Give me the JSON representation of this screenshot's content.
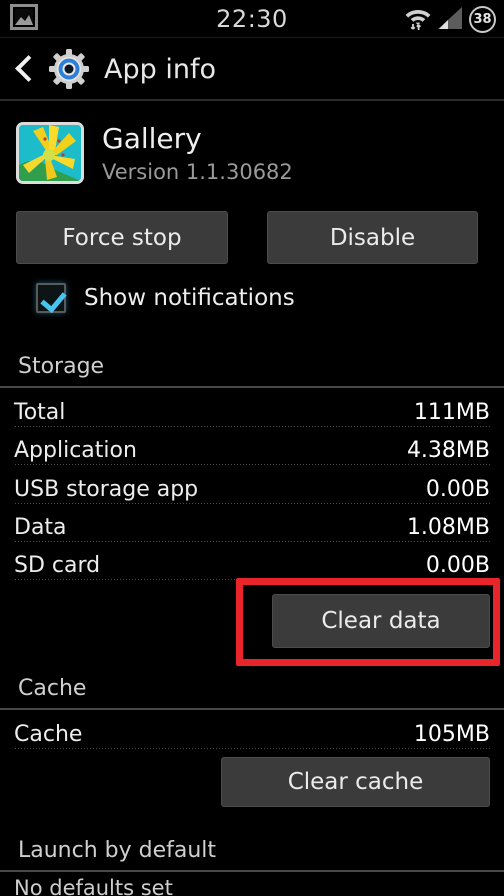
{
  "status_bar": {
    "notification_icon": "photo-icon",
    "clock": "22:30",
    "wifi_icon": "wifi-icon",
    "signal_icon": "cellular-signal-icon",
    "battery_level": "38"
  },
  "action_bar": {
    "back_icon": "back-chevron-icon",
    "app_icon": "settings-gear-icon",
    "title": "App info"
  },
  "app": {
    "icon": "gallery-app-icon",
    "name": "Gallery",
    "version": "Version 1.1.30682"
  },
  "actions": {
    "force_stop_label": "Force stop",
    "disable_label": "Disable"
  },
  "notifications": {
    "label": "Show notifications",
    "checked": true,
    "checkbox_icon": "checkbox-checked-icon"
  },
  "storage": {
    "header": "Storage",
    "rows": [
      {
        "label": "Total",
        "value": "111MB"
      },
      {
        "label": "Application",
        "value": "4.38MB"
      },
      {
        "label": "USB storage app",
        "value": "0.00B"
      },
      {
        "label": "Data",
        "value": "1.08MB"
      },
      {
        "label": "SD card",
        "value": "0.00B"
      }
    ],
    "clear_data_label": "Clear data"
  },
  "cache": {
    "header": "Cache",
    "row": {
      "label": "Cache",
      "value": "105MB"
    },
    "clear_cache_label": "Clear cache"
  },
  "launch_by_default": {
    "header": "Launch by default",
    "status": "No defaults set"
  },
  "colors": {
    "background": "#000000",
    "button": "#3b3b3b",
    "accent_check": "#49c3f0",
    "highlight_red": "#e8252a",
    "divider": "#474747"
  }
}
